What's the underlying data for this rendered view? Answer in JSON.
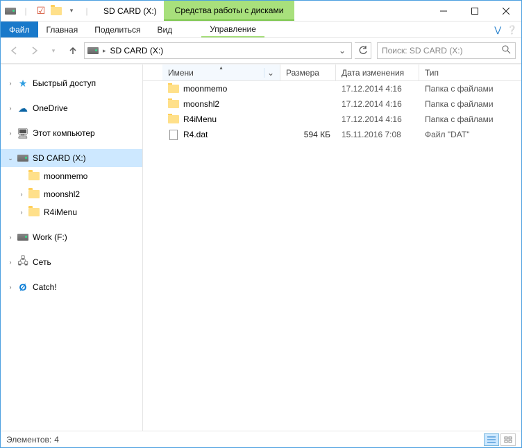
{
  "window": {
    "title": "SD CARD (X:)"
  },
  "ribbon": {
    "file": "Файл",
    "home": "Главная",
    "share": "Поделиться",
    "view": "Вид",
    "context_tools": "Средства работы с дисками",
    "context_manage": "Управление"
  },
  "nav": {
    "breadcrumb": "SD CARD (X:)",
    "search_placeholder": "Поиск: SD CARD (X:)"
  },
  "tree": {
    "quick_access": "Быстрый доступ",
    "onedrive": "OneDrive",
    "this_pc": "Этот компьютер",
    "sdcard": "SD CARD (X:)",
    "sd_children": [
      "moonmemo",
      "moonshl2",
      "R4iMenu"
    ],
    "work": "Work (F:)",
    "network": "Сеть",
    "catch": "Catch!"
  },
  "columns": {
    "name": "Имени",
    "size": "Размера",
    "date": "Дата изменения",
    "type": "Тип"
  },
  "rows": [
    {
      "name": "moonmemo",
      "kind": "folder",
      "size": "",
      "date": "17.12.2014 4:16",
      "type": "Папка с файлами"
    },
    {
      "name": "moonshl2",
      "kind": "folder",
      "size": "",
      "date": "17.12.2014 4:16",
      "type": "Папка с файлами"
    },
    {
      "name": "R4iMenu",
      "kind": "folder",
      "size": "",
      "date": "17.12.2014 4:16",
      "type": "Папка с файлами"
    },
    {
      "name": "R4.dat",
      "kind": "file",
      "size": "594 КБ",
      "date": "15.11.2016 7:08",
      "type": "Файл \"DAT\""
    }
  ],
  "status": {
    "items_label": "Элементов:",
    "count": "4"
  }
}
